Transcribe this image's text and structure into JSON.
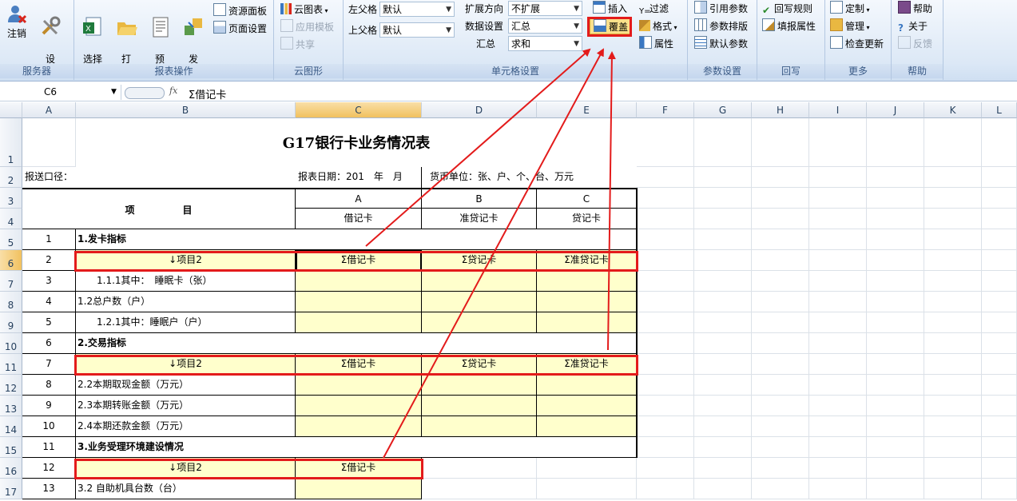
{
  "ribbon": {
    "groups": {
      "server": "服务器",
      "report_ops": "报表操作",
      "cloud": "云图形",
      "cell_settings": "单元格设置",
      "param_settings": "参数设置",
      "writeback": "回写",
      "more": "更多",
      "help": "帮助"
    },
    "server": {
      "logout": "注销",
      "settings": "设\n置"
    },
    "report_ops": {
      "select_template": "选择\n模板",
      "open": "打\n开",
      "preview": "预\n览",
      "publish": "发\n布",
      "resource_panel": "资源面板",
      "page_setup": "页面设置"
    },
    "cloud": {
      "cloud_chart": "云图表",
      "apply_template": "应用模板",
      "share": "共享"
    },
    "cell": {
      "left_parent_label": "左父格",
      "left_parent_value": "默认",
      "up_parent_label": "上父格",
      "up_parent_value": "默认",
      "expand_dir_label": "扩展方向",
      "expand_dir_value": "不扩展",
      "data_setting_label": "数据设置",
      "data_setting_value": "汇总",
      "aggregate_label": "汇总",
      "aggregate_value": "求和",
      "insert": "插入",
      "cover": "覆盖",
      "filter": "过滤",
      "format": "格式",
      "property": "属性"
    },
    "params": {
      "ref_params": "引用参数",
      "param_layout": "参数排版",
      "default_params": "默认参数"
    },
    "writeback": {
      "rule": "回写规则",
      "fill_prop": "填报属性"
    },
    "more": {
      "custom": "定制",
      "manage": "管理",
      "check_update": "检查更新"
    },
    "help": {
      "help": "帮助",
      "about": "关于",
      "feedback": "反馈"
    }
  },
  "formula_bar": {
    "cell_ref": "C6",
    "fx": "fx",
    "content": "Σ借记卡"
  },
  "columns": [
    "A",
    "B",
    "C",
    "D",
    "E",
    "F",
    "G",
    "H",
    "I",
    "J",
    "K",
    "L"
  ],
  "rows": [
    "1",
    "2",
    "3",
    "4",
    "5",
    "6",
    "7",
    "8",
    "9",
    "10",
    "11",
    "12",
    "13",
    "14",
    "15",
    "16",
    "17"
  ],
  "sheet": {
    "title": "G17银行卡业务情况表",
    "report_scope": "报送口径：",
    "report_date": "报表日期：201　年　月",
    "currency_unit": "货币单位：张、户、个、台、万元",
    "header_item": "项　　　　　目",
    "header_codes": [
      "A",
      "B",
      "C"
    ],
    "header_names": [
      "借记卡",
      "准贷记卡",
      "贷记卡"
    ],
    "row_numbers": [
      "1",
      "2",
      "3",
      "4",
      "5",
      "6",
      "7",
      "8",
      "9",
      "10",
      "11",
      "12",
      "13"
    ],
    "row_labels": [
      "1.发卡指标",
      "↓项目2",
      "　　1.1.1其中：　睡眠卡（张）",
      "1.2总户数（户）",
      "　　1.2.1其中：睡眠户（户）",
      "2.交易指标",
      "↓项目2",
      "2.2本期取现金额（万元）",
      "2.3本期转账金额（万元）",
      "2.4本期还款金额（万元）",
      "3.业务受理环境建设情况",
      "↓项目2",
      "3.2 自助机具台数（台）"
    ],
    "row6": [
      "Σ借记卡",
      "Σ贷记卡",
      "Σ准贷记卡"
    ],
    "row11": [
      "Σ借记卡",
      "Σ贷记卡",
      "Σ准贷记卡"
    ],
    "row16": [
      "Σ借记卡"
    ]
  },
  "colors": {
    "highlight_red": "#e31b1b",
    "cell_yellow": "#ffffcc",
    "selected_header": "#f1c15f"
  }
}
